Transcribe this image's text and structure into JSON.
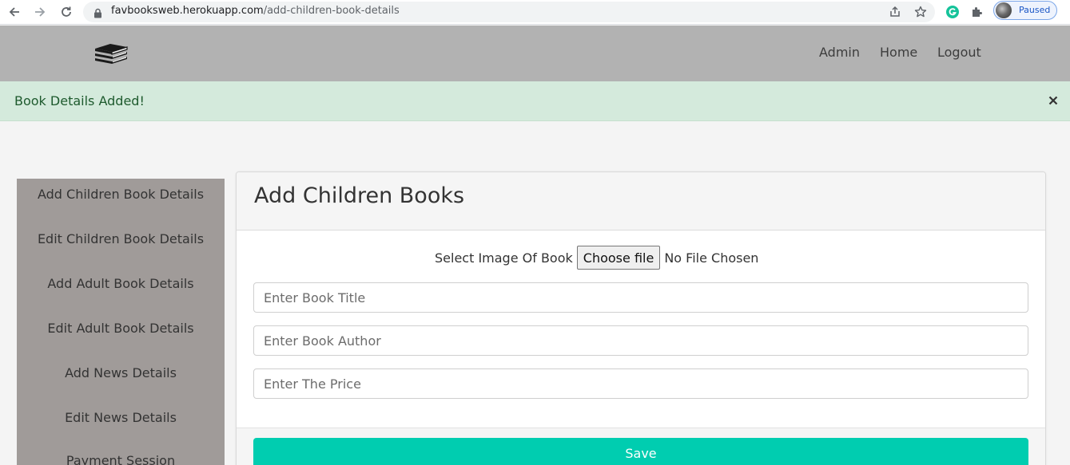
{
  "browser": {
    "url_host": "favbooksweb.herokuapp.com",
    "url_path": "/add-children-book-details",
    "profile_status": "Paused",
    "icons": [
      "back-arrow-icon",
      "forward-arrow-icon",
      "reload-icon",
      "lock-icon",
      "share-icon",
      "star-icon",
      "grammarly-icon",
      "extensions-puzzle-icon"
    ]
  },
  "header": {
    "logo_icon": "books-stack-icon",
    "nav": [
      "Admin",
      "Home",
      "Logout"
    ]
  },
  "alert": {
    "message": "Book Details Added!",
    "close_glyph": "×"
  },
  "sidebar": {
    "items": [
      "Add Children Book Details",
      "Edit Children Book Details",
      "Add Adult Book Details",
      "Edit Adult Book Details",
      "Add News Details",
      "Edit News Details",
      "Payment Session"
    ]
  },
  "form": {
    "title": "Add Children Books",
    "file_label": "Select Image Of Book",
    "file_button": "Choose file",
    "file_status": "No File Chosen",
    "title_placeholder": "Enter Book Title",
    "author_placeholder": "Enter Book Author",
    "price_placeholder": "Enter The Price",
    "save_label": "Save"
  },
  "colors": {
    "header_bg": "#b2b2b2",
    "alert_bg": "#d4eadc",
    "sidebar_bg": "#a09b99",
    "save_accent": "#00cdb0"
  }
}
